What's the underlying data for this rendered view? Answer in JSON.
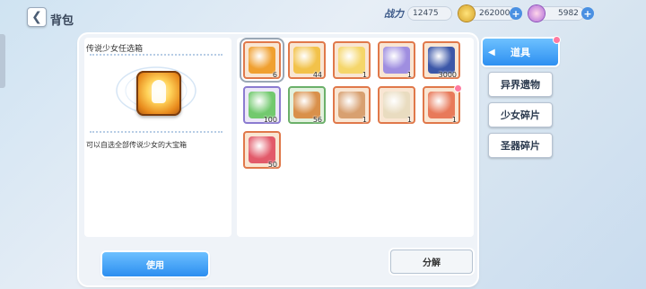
{
  "header": {
    "back_icon": "chevron-left-icon",
    "title": "背包"
  },
  "resources": {
    "power_label": "战力",
    "power_value": "12475",
    "gold_value": "262000",
    "gem_value": "5982",
    "gold_icon": "coin-icon",
    "gem_icon": "gem-icon"
  },
  "detail": {
    "name": "传说少女任选箱",
    "description": "可以自选全部传说少女的大宝箱"
  },
  "items": [
    {
      "name": "legendary-girl-box",
      "count": "6",
      "selected": true,
      "color": "#f0a030",
      "frame": "orange"
    },
    {
      "name": "gold-ticket",
      "count": "44",
      "color": "#f2c24a",
      "frame": "orange"
    },
    {
      "name": "rainbow-ticket",
      "count": "1",
      "color": "#f5d66a",
      "frame": "orange"
    },
    {
      "name": "purple-ticket",
      "count": "1",
      "color": "#9f8ee0",
      "frame": "orange"
    },
    {
      "name": "blue-crystal",
      "count": "3000",
      "color": "#3c57a8",
      "frame": "orange"
    },
    {
      "name": "green-potion",
      "count": "100",
      "color": "#72c96e",
      "frame": "purple"
    },
    {
      "name": "bronze-coins",
      "count": "56",
      "color": "#d9904a",
      "frame": "green"
    },
    {
      "name": "envelope",
      "count": "1",
      "color": "#d8a070",
      "frame": "orange"
    },
    {
      "name": "paper-note",
      "count": "1",
      "color": "#e9dcc0",
      "frame": "orange"
    },
    {
      "name": "red-ticket",
      "count": "1",
      "color": "#e87a5a",
      "frame": "orange",
      "badge": true
    },
    {
      "name": "red-scroll",
      "count": "50",
      "color": "#e25a6a",
      "frame": "orange"
    }
  ],
  "buttons": {
    "use": "使用",
    "decompose": "分解"
  },
  "categories": [
    {
      "label": "道具",
      "active": true
    },
    {
      "label": "异界遗物"
    },
    {
      "label": "少女碎片"
    },
    {
      "label": "圣器碎片"
    }
  ]
}
